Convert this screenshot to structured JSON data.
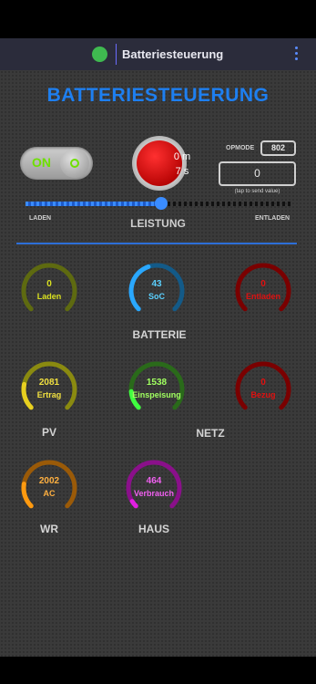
{
  "appbar": {
    "title": "Batteriesteuerung"
  },
  "main": {
    "title": "BATTERIESTEUERUNG",
    "toggle": {
      "label": "ON",
      "state": "on"
    },
    "timer": {
      "line1": "0 m",
      "line2": "7 s"
    },
    "opmode": {
      "label": "OPMODE",
      "value": "802"
    },
    "send_value": "0",
    "send_hint": "(tap to send value)",
    "slider": {
      "left_label": "LADEN",
      "center_label": "LEISTUNG",
      "right_label": "ENTLADEN",
      "position": 0.51
    }
  },
  "sections": {
    "batterie": "BATTERIE",
    "pv": "PV",
    "netz": "NETZ",
    "wr": "WR",
    "haus": "HAUS"
  },
  "gauges": [
    {
      "id": "laden",
      "value": "0",
      "label": "Laden",
      "fraction": 0.0,
      "color": "#8a9a1a",
      "track": "#5e6a10",
      "text": "#d8e020"
    },
    {
      "id": "soc",
      "value": "43",
      "label": "SoC",
      "fraction": 0.43,
      "color": "#2aa8ff",
      "track": "#135a88",
      "text": "#5ad0ff"
    },
    {
      "id": "entladen",
      "value": "0",
      "label": "Entladen",
      "fraction": 0.0,
      "color": "#b80000",
      "track": "#7a0000",
      "text": "#e01010"
    },
    {
      "id": "ertrag",
      "value": "2081",
      "label": "Ertrag",
      "fraction": 0.21,
      "color": "#e8d020",
      "track": "#8a8a10",
      "text": "#f0e040"
    },
    {
      "id": "einspeisung",
      "value": "1538",
      "label": "Einspeisung",
      "fraction": 0.15,
      "color": "#40ff40",
      "track": "#2a6a1a",
      "text": "#a0ff60"
    },
    {
      "id": "bezug",
      "value": "0",
      "label": "Bezug",
      "fraction": 0.0,
      "color": "#b80000",
      "track": "#7a0000",
      "text": "#e01010"
    },
    {
      "id": "ac",
      "value": "2002",
      "label": "AC",
      "fraction": 0.2,
      "color": "#ff9a10",
      "track": "#9a5a08",
      "text": "#ffb040"
    },
    {
      "id": "verbrauch",
      "value": "464",
      "label": "Verbrauch",
      "fraction": 0.05,
      "color": "#e020e0",
      "track": "#8a108a",
      "text": "#f060f0"
    }
  ]
}
